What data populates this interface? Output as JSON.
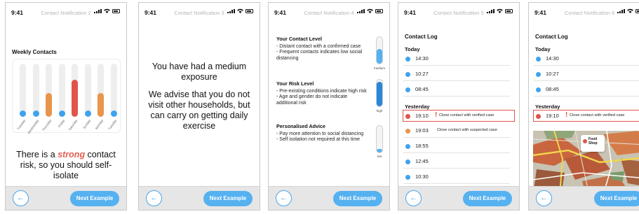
{
  "colors": {
    "accent": "#56b1f0",
    "red": "#e0544b",
    "orange": "#e9954b",
    "blue": "#3ea3ee",
    "gray": "#cccccc"
  },
  "status_time": "9:41",
  "footer": {
    "back_icon": "←",
    "next_label": "Next Example"
  },
  "screens": [
    {
      "title": "Contact Notification 2",
      "heading": "Weekly Contacts",
      "days": [
        {
          "label": "Tuesday",
          "level": 0.12,
          "color": "blue"
        },
        {
          "label": "Wednesday",
          "level": 0.12,
          "color": "blue"
        },
        {
          "label": "Thursday",
          "level": 0.45,
          "color": "orange"
        },
        {
          "label": "Friday",
          "level": 0.12,
          "color": "blue"
        },
        {
          "label": "Saturday",
          "level": 0.7,
          "color": "red"
        },
        {
          "label": "Sunday",
          "level": 0.12,
          "color": "blue"
        },
        {
          "label": "Monday",
          "level": 0.45,
          "color": "orange"
        },
        {
          "label": "Tuesday",
          "level": 0.12,
          "color": "blue"
        }
      ],
      "risk_before": "There is a ",
      "risk_word": "strong",
      "risk_after": " contact risk, so you should self-isolate"
    },
    {
      "title": "Contact Notification 3",
      "line1": "You have had a medium exposure",
      "line2": "We advise that you do not visit other households, but can carry on getting daily exercise"
    },
    {
      "title": "Contact Notification 4",
      "blocks": [
        {
          "heading": "Your Contact Level",
          "lines": [
            "- Distant contact with a confirmed case",
            "- Frequent contacts indicates low social distancing"
          ],
          "gauge_label": "medium",
          "level": 0.55
        },
        {
          "heading": "Your Risk Level",
          "lines": [
            "- Pre-existing conditions indicate high risk",
            "- Age and gender do not indicate additional risk"
          ],
          "gauge_label": "high",
          "level": 0.92
        },
        {
          "heading": "Personalised Advice",
          "lines": [
            "- Pay more attention to social distancing",
            "- Self isolation not required at this time"
          ],
          "gauge_label": "low",
          "level": 0.12
        }
      ]
    },
    {
      "title": "Contact Notification 5",
      "log_title": "Contact Log",
      "today_label": "Today",
      "today": [
        {
          "time": "14:30",
          "color": "blue"
        },
        {
          "time": "10:27",
          "color": "blue"
        },
        {
          "time": "08:45",
          "color": "blue"
        }
      ],
      "yesterday_label": "Yesterday",
      "yesterday": [
        {
          "time": "19:10",
          "color": "red",
          "alert": "!",
          "desc": "Close contact with verified case",
          "highlight": true
        },
        {
          "time": "19:03",
          "color": "orange",
          "alert": "",
          "desc": "Close contact with suspected case",
          "highlight": false
        },
        {
          "time": "18:55",
          "color": "blue",
          "alert": "",
          "desc": "",
          "highlight": false
        },
        {
          "time": "12:45",
          "color": "blue",
          "alert": "",
          "desc": "",
          "highlight": false
        },
        {
          "time": "10:30",
          "color": "blue",
          "alert": "",
          "desc": "",
          "highlight": false
        }
      ]
    },
    {
      "title": "Contact Notification 6",
      "log_title": "Contact Log",
      "today_label": "Today",
      "today": [
        {
          "time": "14:30",
          "color": "blue"
        },
        {
          "time": "10:27",
          "color": "blue"
        },
        {
          "time": "08:45",
          "color": "blue"
        }
      ],
      "yesterday_label": "Yesterday",
      "yesterday": [
        {
          "time": "19:10",
          "color": "red",
          "alert": "!",
          "desc": "Close contact with verified case",
          "highlight": true
        }
      ],
      "map_tooltip": "Food Shop"
    }
  ]
}
